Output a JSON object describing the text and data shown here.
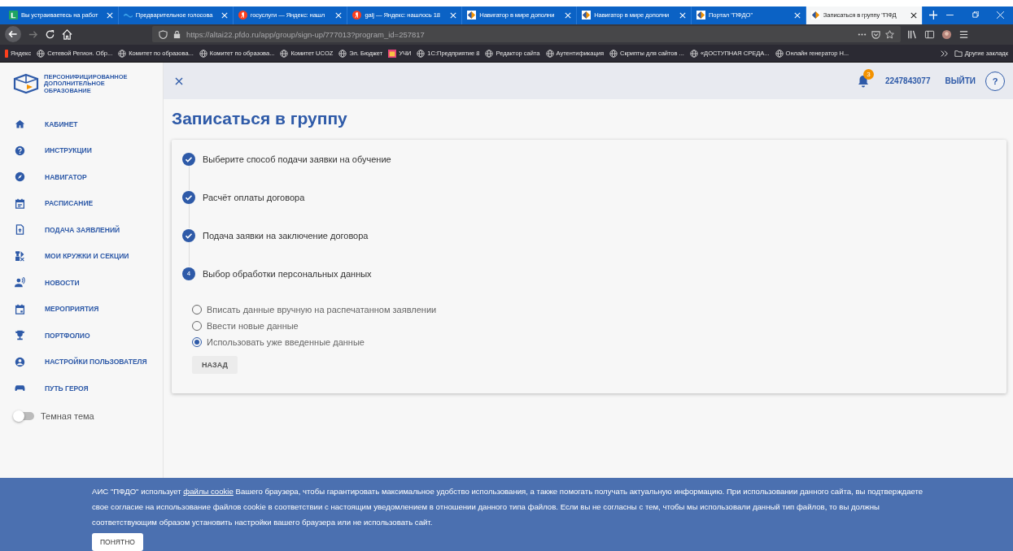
{
  "browser": {
    "tabs": [
      {
        "title": "Вы устраиваетесь на работ",
        "kind": "sheet",
        "selected": false
      },
      {
        "title": "Предварительное голосова",
        "kind": "wave",
        "selected": false
      },
      {
        "title": "госуслуги — Яндекс: нашл",
        "kind": "yandex",
        "selected": false
      },
      {
        "title": "galj — Яндекс: нашлось 18",
        "kind": "yandex",
        "selected": false
      },
      {
        "title": "Навигатор в мире дополни",
        "kind": "navigator",
        "selected": false
      },
      {
        "title": "Навигатор в мире дополни",
        "kind": "navigator",
        "selected": false
      },
      {
        "title": "Портал \"ПФДО\"",
        "kind": "navigator",
        "selected": false
      },
      {
        "title": "Записаться в группу \"ПФД",
        "kind": "navigator",
        "selected": true
      }
    ],
    "url": "https://altai22.pfdo.ru/app/group/sign-up/777013?program_id=257817",
    "bookmarks": [
      {
        "label": "Яндекс",
        "kind": "yandex"
      },
      {
        "label": "Сетевой Регион. Обр...",
        "kind": "globe"
      },
      {
        "label": "Комитет по образова...",
        "kind": "globe"
      },
      {
        "label": "Комитет по образова...",
        "kind": "globe"
      },
      {
        "label": "Комитет UCOZ",
        "kind": "globe"
      },
      {
        "label": "Эл. Бюджет",
        "kind": "globe"
      },
      {
        "label": "УЧИ",
        "kind": "app"
      },
      {
        "label": "1С:Предприятие 8",
        "kind": "globe"
      },
      {
        "label": "Редактор сайта",
        "kind": "globe"
      },
      {
        "label": "Аутентификация",
        "kind": "globe"
      },
      {
        "label": "Скрипты для сайтов ...",
        "kind": "globe"
      },
      {
        "label": "«ДОСТУПНАЯ СРЕДА...",
        "kind": "globe"
      },
      {
        "label": "Онлайн генератор Н...",
        "kind": "globe"
      }
    ],
    "other_bookmarks": "Другие закладк"
  },
  "logo": [
    "ПЕРСОНИФИЦИРОВАННОЕ",
    "ДОПОЛНИТЕЛЬНОЕ",
    "ОБРАЗОВАНИЕ"
  ],
  "sidebar": {
    "items": [
      "КАБИНЕТ",
      "ИНСТРУКЦИИ",
      "НАВИГАТОР",
      "РАСПИСАНИЕ",
      "ПОДАЧА ЗАЯВЛЕНИЙ",
      "МОИ КРУЖКИ И СЕКЦИИ",
      "НОВОСТИ",
      "МЕРОПРИЯТИЯ",
      "ПОРТФОЛИО",
      "НАСТРОЙКИ ПОЛЬЗОВАТЕЛЯ",
      "ПУТЬ ГЕРОЯ"
    ],
    "dark_theme": {
      "label": "Темная тема",
      "on": false
    }
  },
  "header": {
    "notifications": "3",
    "account": "2247843077",
    "logout": "ВЫЙТИ",
    "help": "?"
  },
  "title": "Записаться в группу",
  "steps": [
    {
      "label": "Выберите способ подачи заявки на обучение",
      "done": true
    },
    {
      "label": "Расчёт оплаты договора",
      "done": true
    },
    {
      "label": "Подача заявки на заключение договора",
      "done": true
    },
    {
      "label": "Выбор обработки персональных данных",
      "done": false,
      "number": "4"
    }
  ],
  "options": [
    {
      "label": "Вписать данные вручную на распечатанном заявлении",
      "selected": false
    },
    {
      "label": "Ввести новые данные",
      "selected": false
    },
    {
      "label": "Использовать уже введенные данные",
      "selected": true
    }
  ],
  "back_button": "НАЗАД",
  "cookie": {
    "text": "АИС \"ПФДО\" использует **файлы cookie** Вашего браузера, чтобы гарантировать максимальное удобство использования, а также помогать получать актуальную информацию. При использовании данного сайта, вы подтверждаете свое согласие на использование файлов cookie в соответствии с настоящим уведомлением в отношении данного типа файлов. Если вы не согласны с тем, чтобы мы использовали данный тип файлов, то вы должны соответствующим образом установить настройки вашего браузера или не использовать сайт.",
    "button": "ПОНЯТНО"
  }
}
